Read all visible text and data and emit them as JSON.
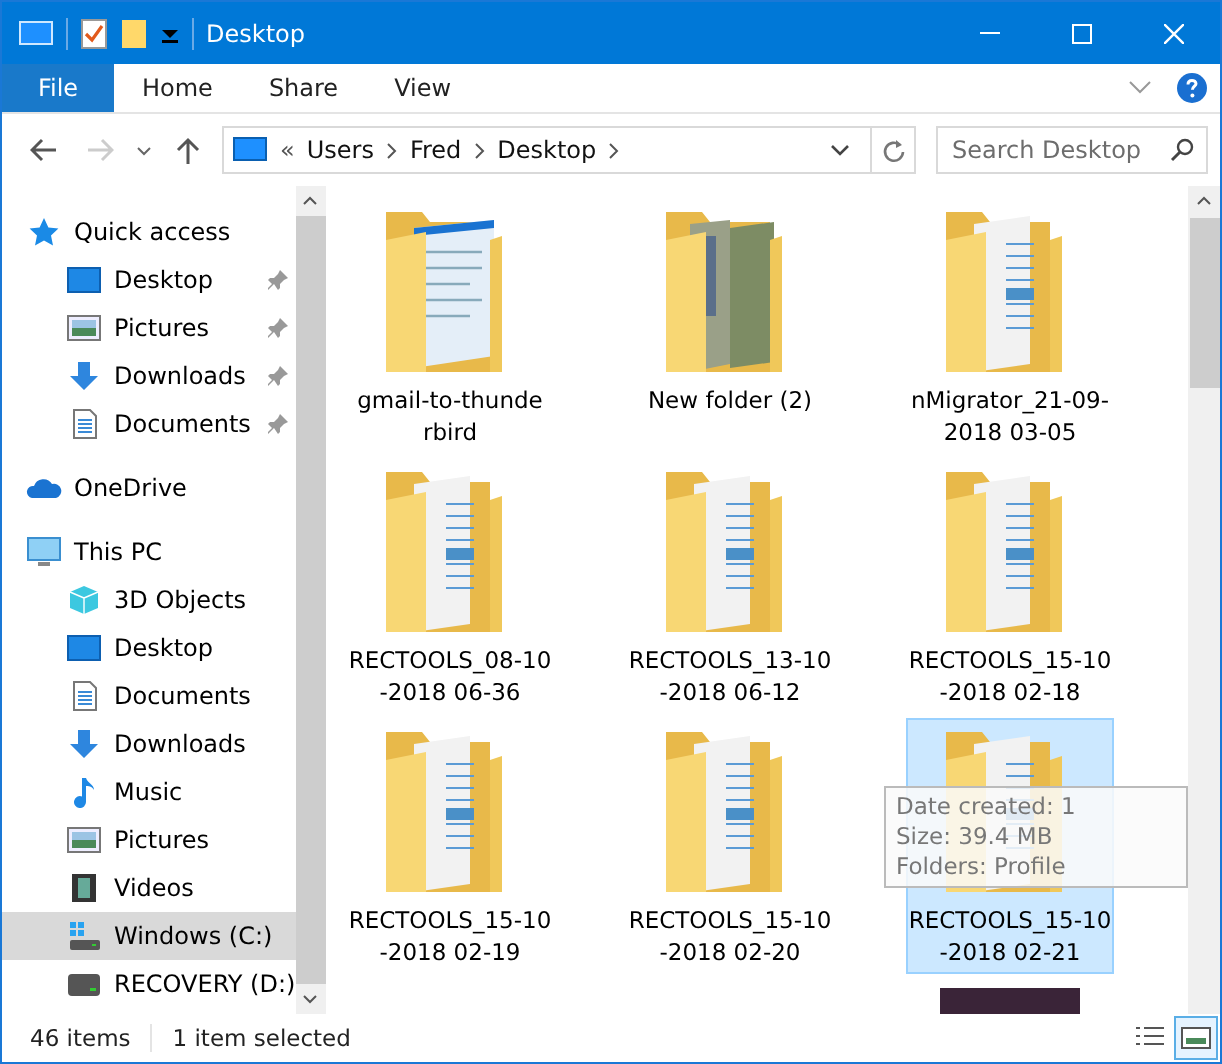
{
  "window": {
    "title": "Desktop"
  },
  "ribbon_tabs": [
    {
      "label": "File",
      "kind": "file"
    },
    {
      "label": "Home",
      "kind": "tab"
    },
    {
      "label": "Share",
      "kind": "tab"
    },
    {
      "label": "View",
      "kind": "tab"
    }
  ],
  "nav": {
    "forward_disabled": true
  },
  "address": {
    "overflow": "«",
    "path": [
      "Users",
      "Fred",
      "Desktop"
    ]
  },
  "search": {
    "placeholder": "Search Desktop"
  },
  "sidebar": {
    "items": [
      {
        "label": "Quick access",
        "kind": "star",
        "selected": false,
        "children": [
          {
            "label": "Desktop",
            "kind": "desktop",
            "pinned": true,
            "selected": false
          },
          {
            "label": "Pictures",
            "kind": "pictures",
            "pinned": true,
            "selected": false
          },
          {
            "label": "Downloads",
            "kind": "download",
            "pinned": true,
            "selected": false
          },
          {
            "label": "Documents",
            "kind": "documents",
            "pinned": true,
            "selected": false
          }
        ]
      },
      {
        "label": "OneDrive",
        "kind": "cloud",
        "selected": false
      },
      {
        "label": "This PC",
        "kind": "pc",
        "selected": false,
        "children": [
          {
            "label": "3D Objects",
            "kind": "cube",
            "pinned": false,
            "selected": false
          },
          {
            "label": "Desktop",
            "kind": "desktop",
            "pinned": false,
            "selected": false
          },
          {
            "label": "Documents",
            "kind": "documents",
            "pinned": false,
            "selected": false
          },
          {
            "label": "Downloads",
            "kind": "download",
            "pinned": false,
            "selected": false
          },
          {
            "label": "Music",
            "kind": "music",
            "pinned": false,
            "selected": false
          },
          {
            "label": "Pictures",
            "kind": "pictures",
            "pinned": false,
            "selected": false
          },
          {
            "label": "Videos",
            "kind": "videos",
            "pinned": false,
            "selected": false
          },
          {
            "label": "Windows (C:)",
            "kind": "windrive",
            "pinned": false,
            "selected": true
          },
          {
            "label": "RECOVERY (D:)",
            "kind": "drive",
            "pinned": false,
            "selected": false
          }
        ]
      }
    ]
  },
  "files": [
    {
      "name_lines": [
        "gmail-to-thunde",
        "rbird"
      ],
      "kind": "screenshot",
      "selected": false
    },
    {
      "name_lines": [
        "New folder (2)"
      ],
      "kind": "photos",
      "selected": false
    },
    {
      "name_lines": [
        "nMigrator_21-09-",
        "2018 03-05"
      ],
      "kind": "document",
      "selected": false
    },
    {
      "name_lines": [
        "RECTOOLS_08-10",
        "-2018 06-36"
      ],
      "kind": "document",
      "selected": false
    },
    {
      "name_lines": [
        "RECTOOLS_13-10",
        "-2018 06-12"
      ],
      "kind": "document",
      "selected": false
    },
    {
      "name_lines": [
        "RECTOOLS_15-10",
        "-2018 02-18"
      ],
      "kind": "document",
      "selected": false
    },
    {
      "name_lines": [
        "RECTOOLS_15-10",
        "-2018 02-19"
      ],
      "kind": "document",
      "selected": false
    },
    {
      "name_lines": [
        "RECTOOLS_15-10",
        "-2018 02-20"
      ],
      "kind": "document",
      "selected": false
    },
    {
      "name_lines": [
        "RECTOOLS_15-10",
        "-2018 02-21"
      ],
      "kind": "document",
      "selected": true
    }
  ],
  "tooltip": [
    "Date created: 1",
    "Size: 39.4 MB",
    "Folders: Profile"
  ],
  "status_bar": {
    "count": "46 items",
    "selection": "1 item selected",
    "views": [
      {
        "kind": "details",
        "selected": false
      },
      {
        "kind": "large-icons",
        "selected": true
      }
    ]
  }
}
